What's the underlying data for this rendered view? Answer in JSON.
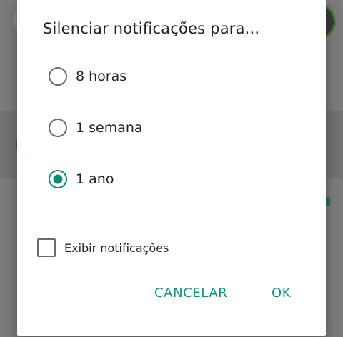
{
  "dialog": {
    "title": "Silenciar notificações para...",
    "options": [
      {
        "label": "8 horas",
        "selected": false
      },
      {
        "label": "1 semana",
        "selected": false
      },
      {
        "label": "1 ano",
        "selected": true
      }
    ],
    "checkbox": {
      "label": "Exibir notificações",
      "checked": false
    },
    "buttons": {
      "cancel": "CANCELAR",
      "ok": "OK"
    }
  },
  "colors": {
    "accent": "#0f8a78",
    "scrim": "#7b7b7b"
  }
}
